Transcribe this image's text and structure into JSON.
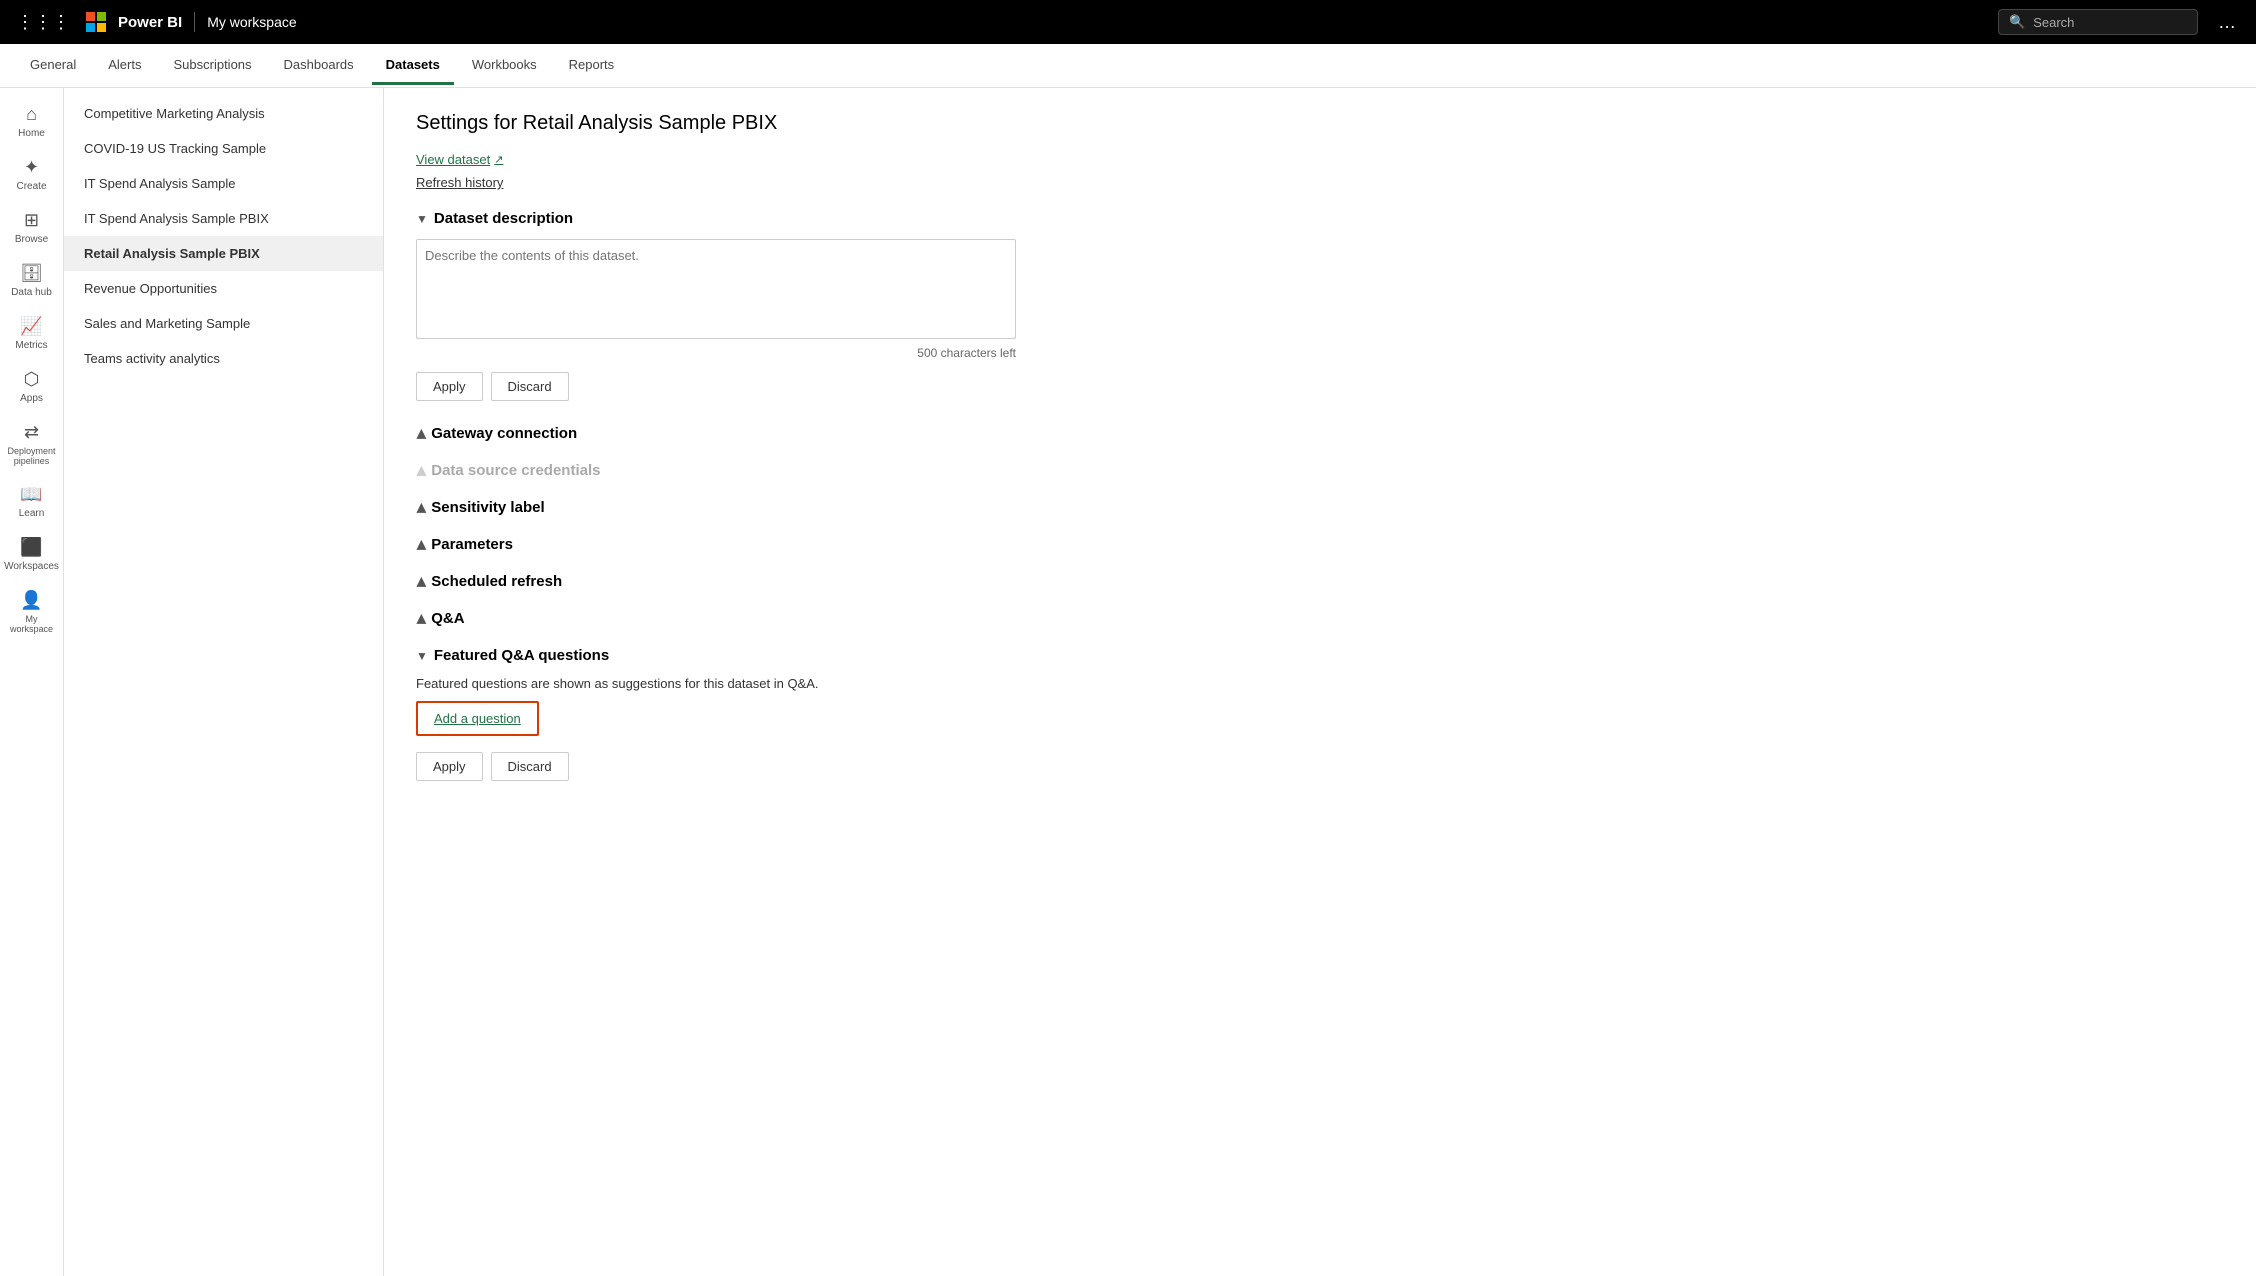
{
  "topbar": {
    "appname": "Power BI",
    "workspace": "My workspace",
    "search_placeholder": "Search",
    "more_icon": "…"
  },
  "subnav": {
    "tabs": [
      {
        "id": "general",
        "label": "General"
      },
      {
        "id": "alerts",
        "label": "Alerts"
      },
      {
        "id": "subscriptions",
        "label": "Subscriptions"
      },
      {
        "id": "dashboards",
        "label": "Dashboards"
      },
      {
        "id": "datasets",
        "label": "Datasets",
        "active": true
      },
      {
        "id": "workbooks",
        "label": "Workbooks"
      },
      {
        "id": "reports",
        "label": "Reports"
      }
    ]
  },
  "leftnav": {
    "items": [
      {
        "id": "home",
        "icon": "⌂",
        "label": "Home"
      },
      {
        "id": "create",
        "icon": "+",
        "label": "Create"
      },
      {
        "id": "browse",
        "icon": "⊞",
        "label": "Browse"
      },
      {
        "id": "datahub",
        "icon": "🗄",
        "label": "Data hub"
      },
      {
        "id": "metrics",
        "icon": "📊",
        "label": "Metrics"
      },
      {
        "id": "apps",
        "icon": "⊡",
        "label": "Apps"
      },
      {
        "id": "deployment",
        "icon": "🔀",
        "label": "Deployment pipelines"
      },
      {
        "id": "learn",
        "icon": "📖",
        "label": "Learn"
      },
      {
        "id": "workspaces",
        "icon": "⬛",
        "label": "Workspaces"
      },
      {
        "id": "myworkspace",
        "icon": "👤",
        "label": "My workspace"
      }
    ]
  },
  "sidebar": {
    "items": [
      {
        "id": "competitive",
        "label": "Competitive Marketing Analysis"
      },
      {
        "id": "covid",
        "label": "COVID-19 US Tracking Sample"
      },
      {
        "id": "it_spend",
        "label": "IT Spend Analysis Sample"
      },
      {
        "id": "it_spend_pbix",
        "label": "IT Spend Analysis Sample PBIX"
      },
      {
        "id": "retail",
        "label": "Retail Analysis Sample PBIX",
        "active": true
      },
      {
        "id": "revenue",
        "label": "Revenue Opportunities"
      },
      {
        "id": "sales",
        "label": "Sales and Marketing Sample"
      },
      {
        "id": "teams",
        "label": "Teams activity analytics"
      }
    ]
  },
  "content": {
    "title": "Settings for Retail Analysis Sample PBIX",
    "view_dataset_label": "View dataset",
    "refresh_history_label": "Refresh history",
    "sections": {
      "dataset_description": {
        "label": "Dataset description",
        "expanded": true,
        "textarea_placeholder": "Describe the contents of this dataset.",
        "char_count": "500 characters left",
        "apply_label": "Apply",
        "discard_label": "Discard"
      },
      "gateway_connection": {
        "label": "Gateway connection",
        "expanded": false
      },
      "data_source_credentials": {
        "label": "Data source credentials",
        "expanded": false,
        "disabled": true
      },
      "sensitivity_label": {
        "label": "Sensitivity label",
        "expanded": false
      },
      "parameters": {
        "label": "Parameters",
        "expanded": false
      },
      "scheduled_refresh": {
        "label": "Scheduled refresh",
        "expanded": false
      },
      "qa": {
        "label": "Q&A",
        "expanded": false
      },
      "featured_qa": {
        "label": "Featured Q&A questions",
        "expanded": true,
        "description": "Featured questions are shown as suggestions for this dataset in Q&A.",
        "add_question_label": "Add a question",
        "apply_label": "Apply",
        "discard_label": "Discard"
      }
    }
  }
}
